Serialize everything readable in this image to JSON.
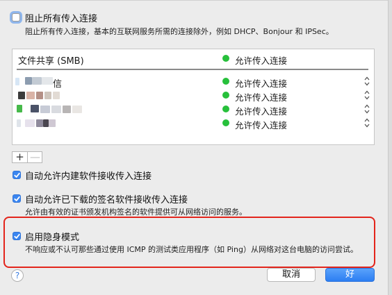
{
  "block_all": {
    "checked": false,
    "label": "阻止所有传入连接",
    "description": "阻止所有传入连接，基本的互联网服务所需的连接除外，例如 DHCP、Bonjour 和 IPSec。"
  },
  "app_list": {
    "rows": [
      {
        "name": "文件共享 (SMB)",
        "status": "允许传入连接"
      },
      {
        "name": "信",
        "status": "允许传入连接"
      },
      {
        "name": "",
        "status": "允许传入连接"
      },
      {
        "name": "",
        "status": "允许传入连接"
      },
      {
        "name": "",
        "status": "允许传入连接"
      }
    ],
    "status_color": "#27c03b",
    "add_symbol": "+",
    "remove_symbol": "—"
  },
  "auto_builtin": {
    "checked": true,
    "label": "自动允许内建软件接收传入连接"
  },
  "auto_signed": {
    "checked": true,
    "label": "自动允许已下载的签名软件接收传入连接",
    "description": "允许由有效的证书颁发机构签名的软件提供可从网络访问的服务。"
  },
  "stealth": {
    "checked": true,
    "label": "启用隐身模式",
    "description": "不响应或不认可那些通过使用 ICMP 的测试类应用程序（如 Ping）从网络对这台电脑的访问尝试。"
  },
  "footer": {
    "help": "?",
    "cancel": "取消",
    "ok": "好"
  },
  "colors": {
    "accent": "#3b86f0",
    "highlight": "#e3241b"
  }
}
